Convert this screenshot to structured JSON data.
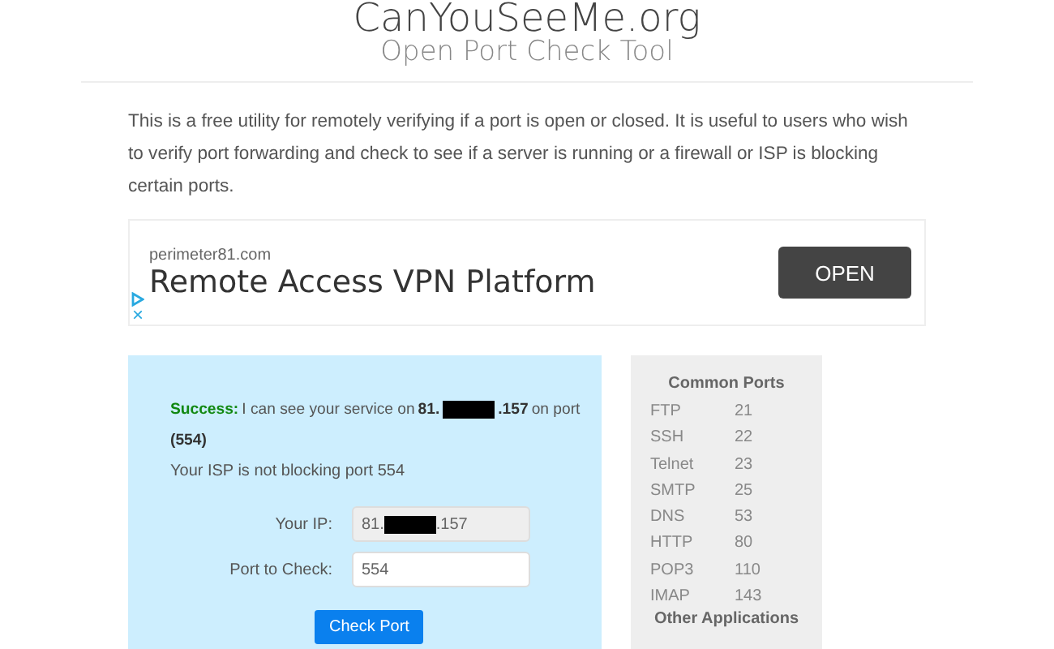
{
  "header": {
    "title": "CanYouSeeMe.org",
    "subtitle": "Open Port Check Tool"
  },
  "intro": "This is a free utility for remotely verifying if a port is open or closed. It is useful to users who wish to verify port forwarding and check to see if a server is running or a firewall or ISP is blocking certain ports.",
  "ad": {
    "domain": "perimeter81.com",
    "headline": "Remote Access VPN Platform",
    "button": "OPEN",
    "close": "×"
  },
  "result": {
    "success": true,
    "label": "Success:",
    "text_before": "I can see your service on",
    "ip_prefix": "81.",
    "ip_suffix": ".157",
    "text_after": "on port",
    "port": "(554)",
    "note": "Your ISP is not blocking port 554"
  },
  "form": {
    "ip_label": "Your IP:",
    "ip_prefix": "81.",
    "ip_suffix": ".157",
    "port_label": "Port to Check:",
    "port_value": "554",
    "button": "Check Port"
  },
  "common_ports": {
    "title": "Common Ports",
    "rows": [
      {
        "name": "FTP",
        "port": "21"
      },
      {
        "name": "SSH",
        "port": "22"
      },
      {
        "name": "Telnet",
        "port": "23"
      },
      {
        "name": "SMTP",
        "port": "25"
      },
      {
        "name": "DNS",
        "port": "53"
      },
      {
        "name": "HTTP",
        "port": "80"
      },
      {
        "name": "POP3",
        "port": "110"
      },
      {
        "name": "IMAP",
        "port": "143"
      }
    ],
    "footer": "Other Applications"
  }
}
